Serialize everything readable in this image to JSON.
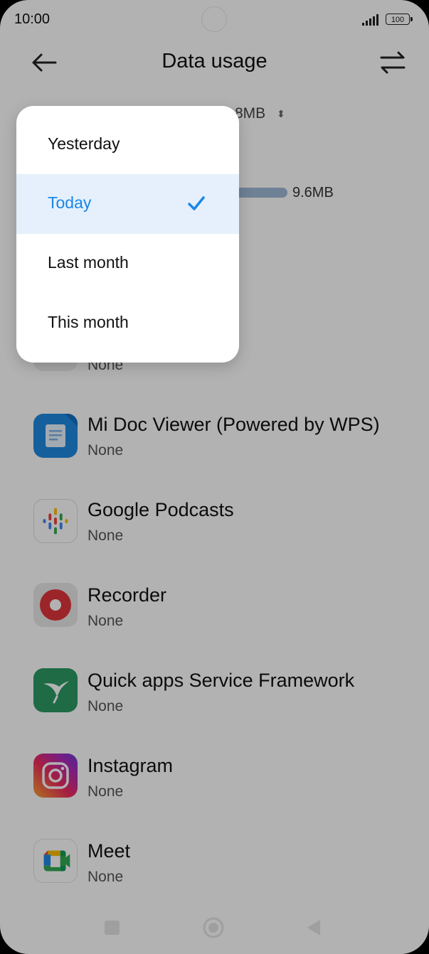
{
  "status_bar": {
    "time": "10:00",
    "battery": "100"
  },
  "header": {
    "title": "Data usage"
  },
  "summary": {
    "amount_fragment": "8MB"
  },
  "usage_bar": {
    "value": "9.6MB"
  },
  "apps": [
    {
      "name": "",
      "sub": "None",
      "icon": "generic-app-icon"
    },
    {
      "name": "Mi Doc Viewer (Powered by WPS)",
      "sub": "None",
      "icon": "mi-doc-viewer-icon"
    },
    {
      "name": "Google Podcasts",
      "sub": "None",
      "icon": "google-podcasts-icon"
    },
    {
      "name": "Recorder",
      "sub": "None",
      "icon": "recorder-icon"
    },
    {
      "name": "Quick apps Service Framework",
      "sub": "None",
      "icon": "quick-apps-icon"
    },
    {
      "name": "Instagram",
      "sub": "None",
      "icon": "instagram-icon"
    },
    {
      "name": "Meet",
      "sub": "None",
      "icon": "meet-icon"
    }
  ],
  "menu": {
    "items": [
      {
        "label": "Yesterday",
        "selected": false
      },
      {
        "label": "Today",
        "selected": true
      },
      {
        "label": "Last month",
        "selected": false
      },
      {
        "label": "This month",
        "selected": false
      }
    ]
  },
  "colors": {
    "accent": "#1a86e8",
    "selected_bg": "#e5f0fc",
    "overlay": "rgba(0,0,0,0.30)"
  }
}
